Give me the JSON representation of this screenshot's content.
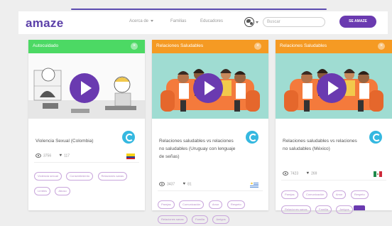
{
  "navbar": {
    "logo": "amaze",
    "links": [
      "Acerca de",
      "Familias",
      "Educadores"
    ],
    "search_placeholder": "Buscar",
    "cta_label": "SE AMAZE"
  },
  "cards": [
    {
      "category": "Autocuidado",
      "header_color": "#4cd964",
      "title": "Violencia Sexual (Colombia)",
      "views": "3756",
      "likes": "117",
      "country_flag": "Colombia",
      "tags": [
        "Violencia sexual",
        "Consentimiento",
        "Relaciones sanas",
        "Límites",
        "Abuso"
      ]
    },
    {
      "category": "Relaciones Saludables",
      "header_color": "#f59a23",
      "title": "Relaciones saludables vs relaciones no saludables (Uruguay con lenguaje de señas)",
      "views": "3437",
      "likes": "81",
      "country_flag": "Uruguay",
      "tags": [
        "Parejas",
        "Comunicación",
        "Amor",
        "Respeto",
        "Relaciones sanas",
        "Familia",
        "Amigos"
      ]
    },
    {
      "category": "Relaciones Saludables",
      "header_color": "#f59a23",
      "title": "Relaciones saludables vs relaciones no saludables (México)",
      "views": "7423",
      "likes": "269",
      "country_flag": "México",
      "tags": [
        "Parejas",
        "Comunicación",
        "Amor",
        "Respeto",
        "Relaciones sanas",
        "Familia",
        "Amigos"
      ]
    }
  ],
  "icons": {
    "close": "close-icon",
    "play": "play-icon",
    "views": "eye-icon",
    "likes": "heart-icon",
    "brand": "amaze-brand-icon",
    "globe": "globe-icon"
  },
  "colors": {
    "brand_purple": "#6a3ab0",
    "green_header": "#4cd964",
    "orange_header": "#f59a23",
    "tag_border": "#c9a6dc",
    "brand_blue": "#35b8e0"
  }
}
